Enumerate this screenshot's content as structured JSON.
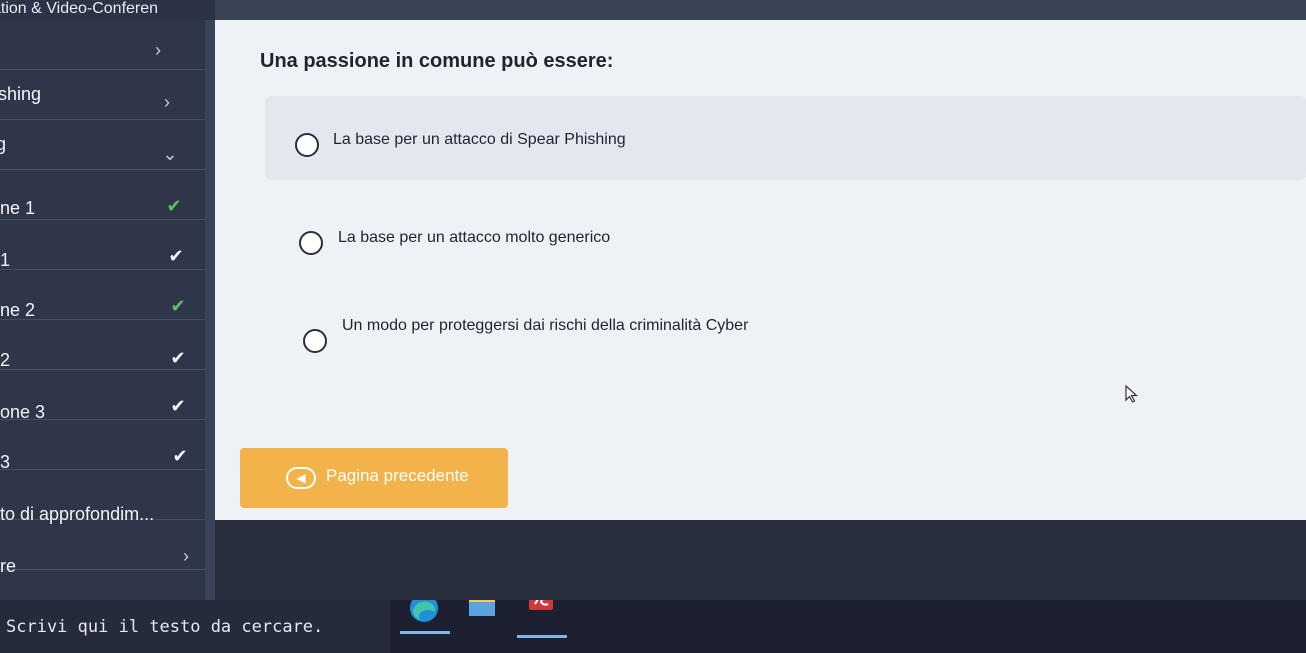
{
  "app": {
    "window_title": "ation & Video-Conferen"
  },
  "sidebar": {
    "items": [
      {
        "label": "",
        "mark": "›",
        "mark_type": "chevron-right"
      },
      {
        "label": "shing",
        "mark": "›",
        "mark_type": "chevron-right"
      },
      {
        "label": "g",
        "mark": "⌄",
        "mark_type": "chevron-down"
      },
      {
        "label": "ne 1",
        "mark": "✔",
        "mark_type": "check-green"
      },
      {
        "label": "1",
        "mark": "✔",
        "mark_type": "check-white"
      },
      {
        "label": "ne 2",
        "mark": "✔",
        "mark_type": "check-green"
      },
      {
        "label": "2",
        "mark": "✔",
        "mark_type": "check-white"
      },
      {
        "label": "one 3",
        "mark": "✔",
        "mark_type": "check-white"
      },
      {
        "label": "3",
        "mark": "✔",
        "mark_type": "check-white"
      },
      {
        "label": "to di approfondim...",
        "mark": "",
        "mark_type": ""
      },
      {
        "label": "re",
        "mark": "›",
        "mark_type": "chevron-right"
      }
    ]
  },
  "quiz": {
    "question": "Una passione in comune può essere:",
    "options": [
      {
        "label": "La base per un attacco di Spear Phishing"
      },
      {
        "label": "La base per un attacco molto generico"
      },
      {
        "label": "Un modo per proteggersi dai rischi della criminalità Cyber"
      }
    ],
    "prev_button": "Pagina precedente"
  },
  "taskbar": {
    "search_placeholder": "Scrivi qui il testo da cercare.",
    "icons": [
      "edge-browser-icon",
      "file-explorer-icon",
      "acrobat-reader-icon"
    ]
  },
  "colors": {
    "accent_button": "#f2b34a",
    "check_green": "#5fbf5f",
    "sidebar_bg": "#2f3649",
    "content_bg": "#eef1f5"
  }
}
